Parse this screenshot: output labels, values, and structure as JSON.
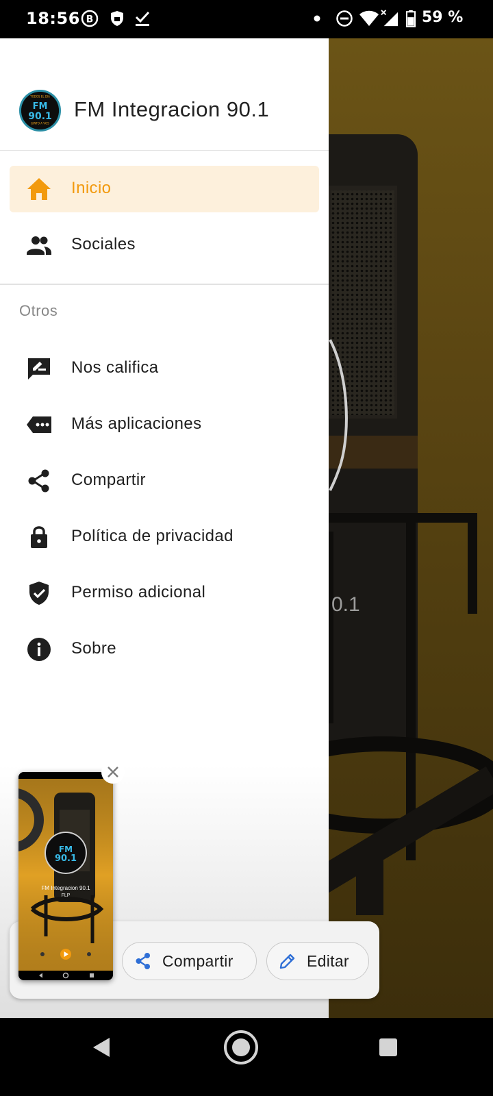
{
  "status_bar": {
    "time": "18:56",
    "icons": [
      "b-icon",
      "shield-icon",
      "check-download-icon",
      "dot-icon",
      "do-not-disturb-icon",
      "wifi-icon",
      "signal-icon",
      "battery-icon"
    ],
    "battery_percent": "59 %"
  },
  "background_app": {
    "station_fragment": "0.1"
  },
  "drawer": {
    "app_title": "FM Integracion 90.1",
    "logo_text": "FM 90.1",
    "primary_items": [
      {
        "label": "Inicio",
        "icon": "home-icon",
        "active": true
      },
      {
        "label": "Sociales",
        "icon": "people-icon",
        "active": false
      }
    ],
    "section_title": "Otros",
    "other_items": [
      {
        "label": "Nos califica",
        "icon": "rate-review-icon"
      },
      {
        "label": "Más aplicaciones",
        "icon": "more-apps-icon"
      },
      {
        "label": "Compartir",
        "icon": "share-icon"
      },
      {
        "label": "Política de privacidad",
        "icon": "lock-icon"
      },
      {
        "label": "Permiso adicional",
        "icon": "verified-shield-icon"
      },
      {
        "label": "Sobre",
        "icon": "info-icon"
      }
    ]
  },
  "screenshot_overlay": {
    "thumbnail_title": "FM Integracion 90.1",
    "thumbnail_subtitle": "FLP",
    "share_label": "Compartir",
    "edit_label": "Editar"
  },
  "colors": {
    "accent": "#f29a0e",
    "active_bg": "#fdf0dc",
    "share_icon": "#2f6fd6"
  }
}
